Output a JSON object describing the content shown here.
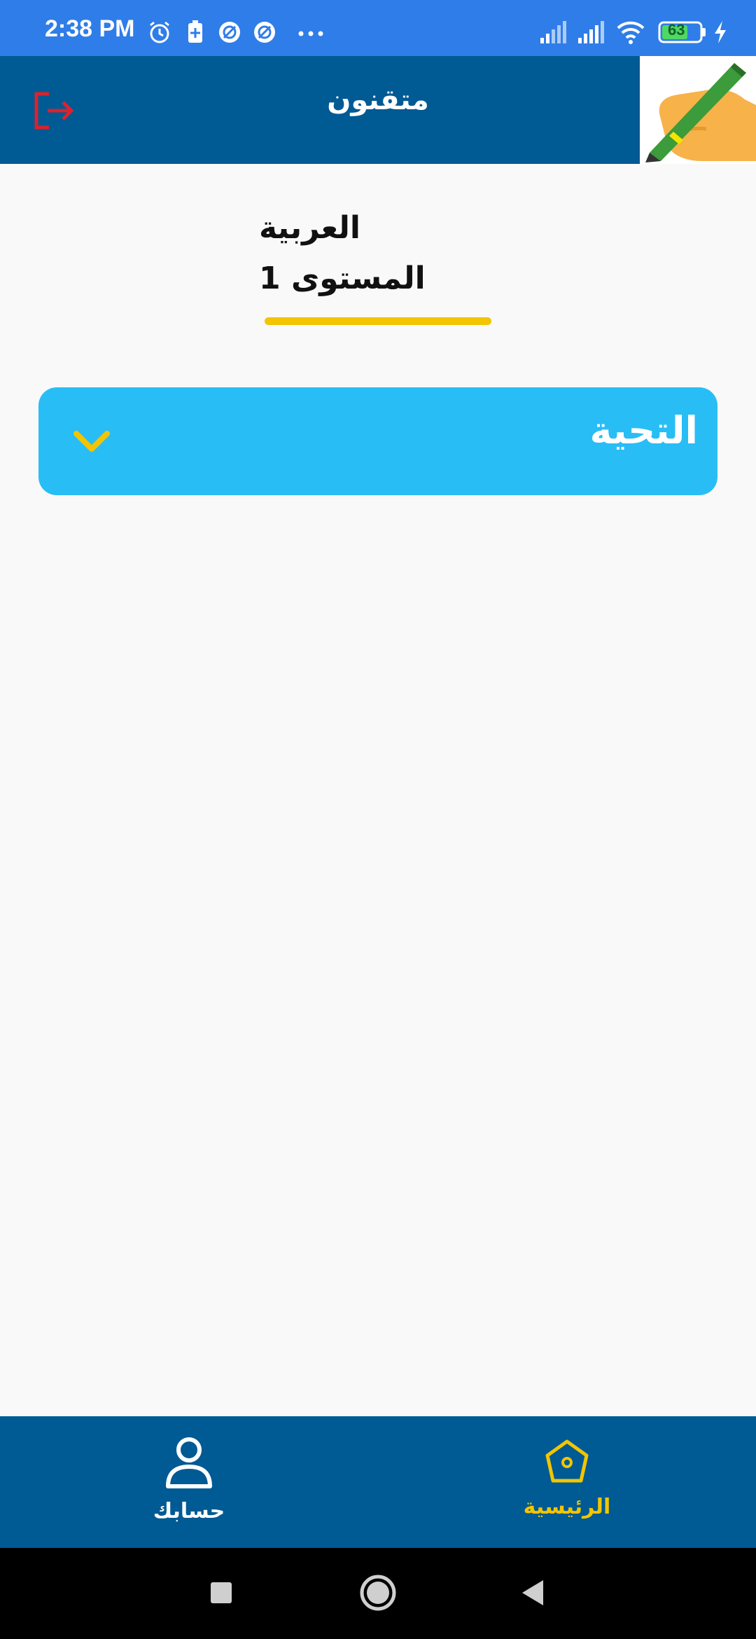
{
  "status_bar": {
    "time": "2:38 PM",
    "battery": "63",
    "icons_left": [
      "alarm-icon",
      "battery-saver-icon",
      "app-notification-icon",
      "app-notification-icon",
      "more-icon"
    ],
    "icons_right": [
      "signal-icon",
      "signal-icon",
      "wifi-icon",
      "battery-icon",
      "charging-icon"
    ]
  },
  "app_bar": {
    "title": "متقنون",
    "logout_icon": "logout-icon",
    "logo_icon": "pen-hand-logo"
  },
  "header": {
    "subject": "العربية",
    "level": "المستوى 1"
  },
  "accordion": {
    "label": "التحية",
    "expanded": false
  },
  "bottom_nav": {
    "items": [
      {
        "label": "حسابك",
        "icon": "person-icon",
        "active": false
      },
      {
        "label": "الرئيسية",
        "icon": "home-icon",
        "active": true
      }
    ]
  },
  "colors": {
    "status_bar": "#2f7de8",
    "app_bar": "#005a94",
    "accordion": "#29bdf6",
    "accent": "#f2c500",
    "logout": "#d9232d"
  }
}
